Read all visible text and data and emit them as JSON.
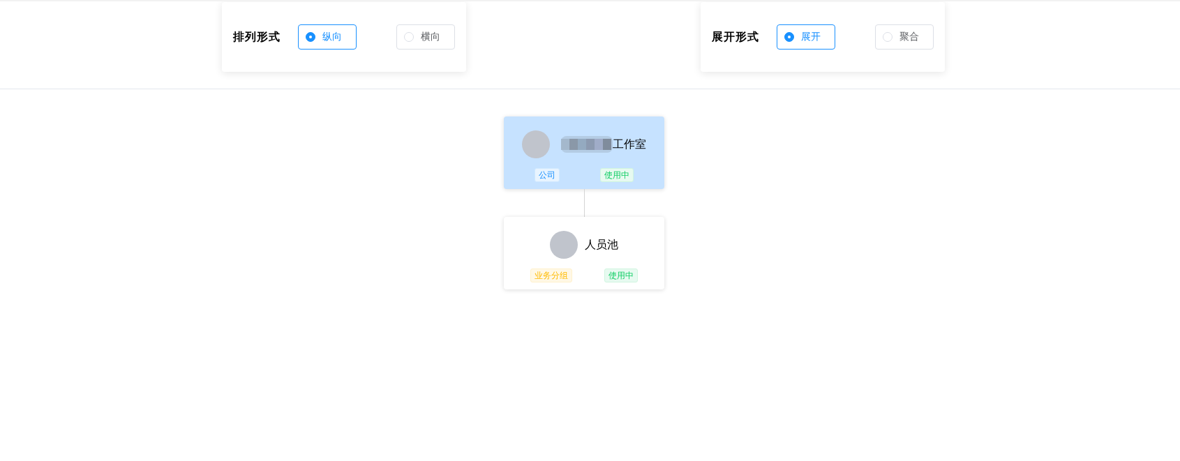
{
  "controls": [
    {
      "title": "排列形式",
      "options": [
        {
          "label": "纵向",
          "selected": true
        },
        {
          "label": "横向",
          "selected": false
        }
      ]
    },
    {
      "title": "展开形式",
      "options": [
        {
          "label": "展开",
          "selected": true
        },
        {
          "label": "聚合",
          "selected": false
        }
      ]
    }
  ],
  "tree": {
    "name": "工作室",
    "name_redacted": true,
    "selected": true,
    "tags": [
      {
        "label": "公司",
        "kind": "primary"
      },
      {
        "label": "使用中",
        "kind": "success"
      }
    ],
    "children": [
      {
        "name": "人员池",
        "name_redacted": false,
        "selected": false,
        "tags": [
          {
            "label": "业务分组",
            "kind": "warning"
          },
          {
            "label": "使用中",
            "kind": "success"
          }
        ]
      }
    ]
  }
}
